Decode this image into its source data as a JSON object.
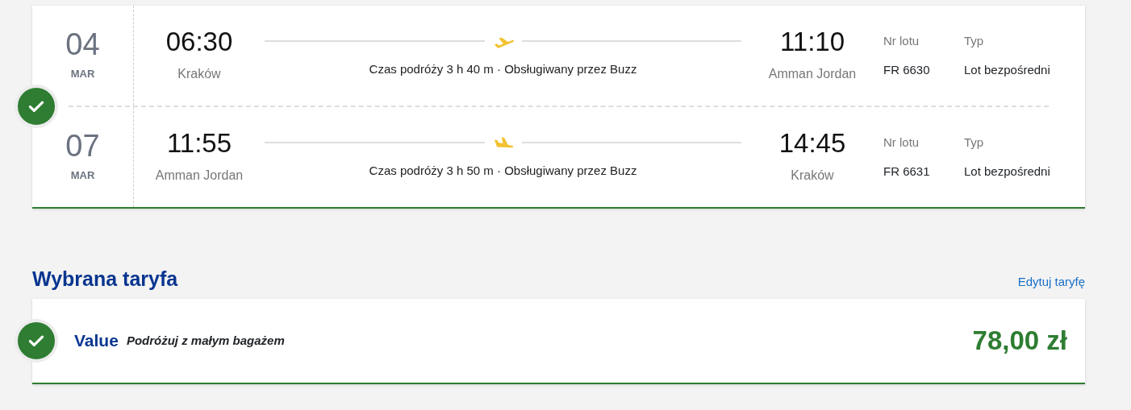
{
  "flights": {
    "selected": true,
    "legs": [
      {
        "day": "04",
        "month": "MAR",
        "departure_time": "06:30",
        "departure_city": "Kraków",
        "kind": "takeoff",
        "info": "Czas podróży 3 h 40 m · Obsługiwany przez Buzz",
        "arrival_time": "11:10",
        "arrival_city": "Amman Jordan",
        "flight_no_label": "Nr lotu",
        "flight_no": "FR 6630",
        "type_label": "Typ",
        "type": "Lot bezpośredni"
      },
      {
        "day": "07",
        "month": "MAR",
        "departure_time": "11:55",
        "departure_city": "Amman Jordan",
        "kind": "landing",
        "info": "Czas podróży 3 h 50 m · Obsługiwany przez Buzz",
        "arrival_time": "14:45",
        "arrival_city": "Kraków",
        "flight_no_label": "Nr lotu",
        "flight_no": "FR 6631",
        "type_label": "Typ",
        "type": "Lot bezpośredni"
      }
    ]
  },
  "fare_section": {
    "title": "Wybrana taryfa",
    "edit_link": "Edytuj taryfę",
    "fare": {
      "selected": true,
      "name": "Value",
      "description": "Podróżuj z małym bagażem",
      "price": "78,00 zł"
    }
  }
}
